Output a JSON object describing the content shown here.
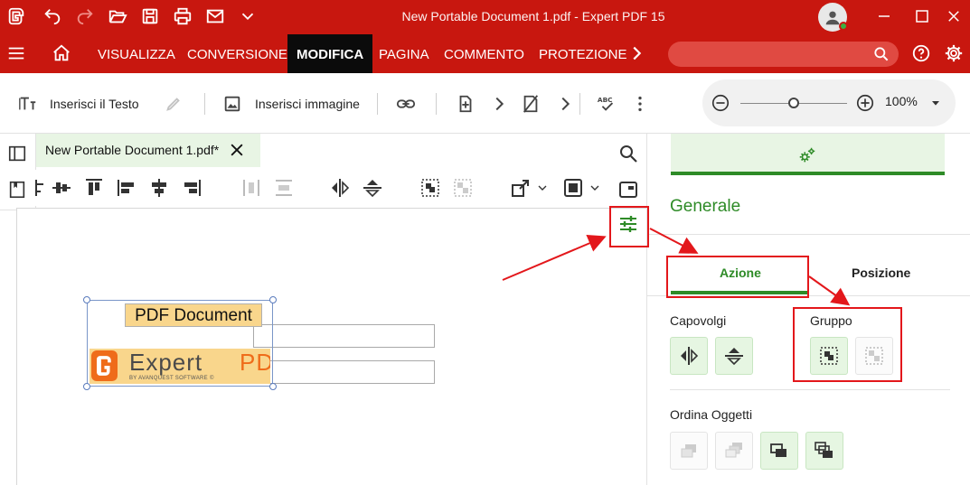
{
  "titlebar": {
    "title": "New Portable Document 1.pdf  -  Expert PDF 15"
  },
  "menu": {
    "items": [
      {
        "label": "VISUALIZZA"
      },
      {
        "label": "CONVERSIONE"
      },
      {
        "label": "MODIFICA",
        "active": true
      },
      {
        "label": "PAGINA"
      },
      {
        "label": "COMMENTO"
      },
      {
        "label": "PROTEZIONE"
      }
    ],
    "search_placeholder": ""
  },
  "toolbar": {
    "insert_text": "Inserisci il Testo",
    "insert_image": "Inserisci immagine",
    "zoom_value": "100%",
    "zoom_level": 0.5
  },
  "document": {
    "tab_label": "New Portable Document 1.pdf*"
  },
  "page_objects": {
    "text_box": "PDF Document",
    "logo_word_1": "Expert",
    "logo_word_2": "PDF",
    "logo_tagline": "BY AVANQUEST SOFTWARE ©"
  },
  "properties": {
    "title": "Generale",
    "tabs": [
      {
        "label": "Azione",
        "active": true
      },
      {
        "label": "Posizione"
      }
    ],
    "flip_label": "Capovolgi",
    "group_label": "Gruppo",
    "order_label": "Ordina Oggetti"
  },
  "colors": {
    "brand_red": "#c8170f",
    "accent_green": "#2e8b27",
    "annotation_red": "#e3171b",
    "highlight_fill": "#f9d68c"
  }
}
